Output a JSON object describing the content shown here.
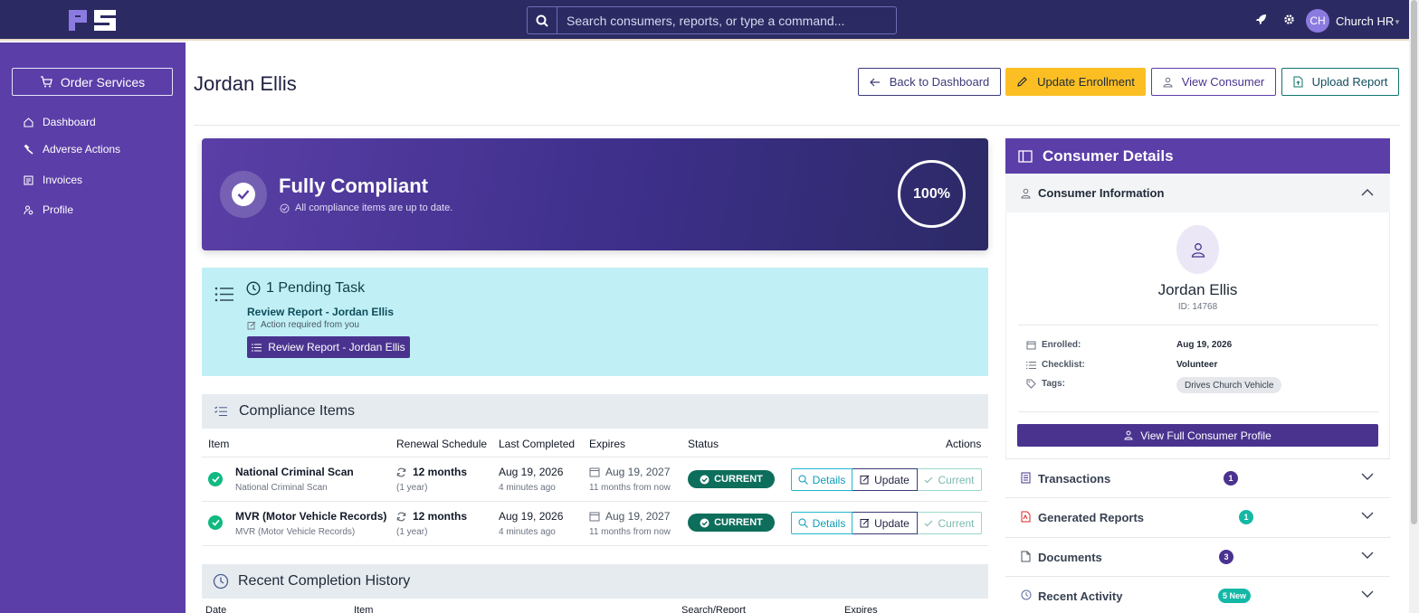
{
  "topbar": {
    "logo_text": "PS",
    "search_placeholder": "Search consumers, reports, or type a command...",
    "user_initials": "CH",
    "user_name": "Church HR",
    "icons": [
      "search-icon",
      "rocket-icon",
      "gear-icon",
      "caret-down-icon"
    ]
  },
  "sidebar": {
    "order_button": "Order Services",
    "items": [
      {
        "label": "Dashboard",
        "icon": "home-icon"
      },
      {
        "label": "Adverse Actions",
        "icon": "gavel-icon"
      },
      {
        "label": "Invoices",
        "icon": "invoice-icon"
      },
      {
        "label": "Profile",
        "icon": "user-cog-icon"
      }
    ]
  },
  "header": {
    "title": "Jordan Ellis",
    "buttons": {
      "back": "Back to Dashboard",
      "update_enrollment": "Update Enrollment",
      "view_consumer": "View Consumer",
      "upload_report": "Upload Report"
    }
  },
  "banner": {
    "title": "Fully Compliant",
    "subtitle": "All compliance items are up to date.",
    "percent": "100%"
  },
  "pending": {
    "title": "1 Pending Task",
    "task": "Review Report - Jordan Ellis",
    "note": "Action required from you",
    "button": "Review Report - Jordan Ellis"
  },
  "compliance": {
    "title": "Compliance Items",
    "columns": [
      "Item",
      "Renewal Schedule",
      "Last Completed",
      "Expires",
      "Status",
      "Actions"
    ],
    "rows": [
      {
        "name": "National Criminal Scan",
        "sub": "National Criminal Scan",
        "renewal": "12 months",
        "renewal_sub": "(1 year)",
        "last": "Aug 19, 2026",
        "last_sub": "4 minutes ago",
        "expires": "Aug 19, 2027",
        "expires_sub": "11 months from now",
        "status": "CURRENT",
        "actions": [
          "Details",
          "Update",
          "Current"
        ]
      },
      {
        "name": "MVR (Motor Vehicle Records)",
        "sub": "MVR (Motor Vehicle Records)",
        "renewal": "12 months",
        "renewal_sub": "(1 year)",
        "last": "Aug 19, 2026",
        "last_sub": "4 minutes ago",
        "expires": "Aug 19, 2027",
        "expires_sub": "11 months from now",
        "status": "CURRENT",
        "actions": [
          "Details",
          "Update",
          "Current"
        ]
      }
    ]
  },
  "history": {
    "title": "Recent Completion History",
    "columns": [
      "Date",
      "Item",
      "Search/Report",
      "Expires"
    ]
  },
  "consumer": {
    "panel_title": "Consumer Details",
    "section_title": "Consumer Information",
    "name": "Jordan Ellis",
    "id": "ID: 14768",
    "enrolled_label": "Enrolled:",
    "enrolled": "Aug 19, 2026",
    "checklist_label": "Checklist:",
    "checklist": "Volunteer",
    "tags_label": "Tags:",
    "tag": "Drives Church Vehicle",
    "full_profile_button": "View Full Consumer Profile",
    "accordions": [
      {
        "label": "Transactions",
        "badge": "1",
        "color": "#4a338f"
      },
      {
        "label": "Generated Reports",
        "badge": "1",
        "color": "#14b8a6"
      },
      {
        "label": "Documents",
        "badge": "3",
        "color": "#4a338f"
      },
      {
        "label": "Recent Activity",
        "badge": "5 New",
        "color": "#14b8a6"
      }
    ]
  },
  "colors": {
    "topbar": "#2b2a63",
    "sidebar": "#5b3ea8",
    "accent": "#4a338f",
    "warning": "#fbbf24",
    "success": "#0d6e5c",
    "pending_bg": "#c0f0f5"
  }
}
